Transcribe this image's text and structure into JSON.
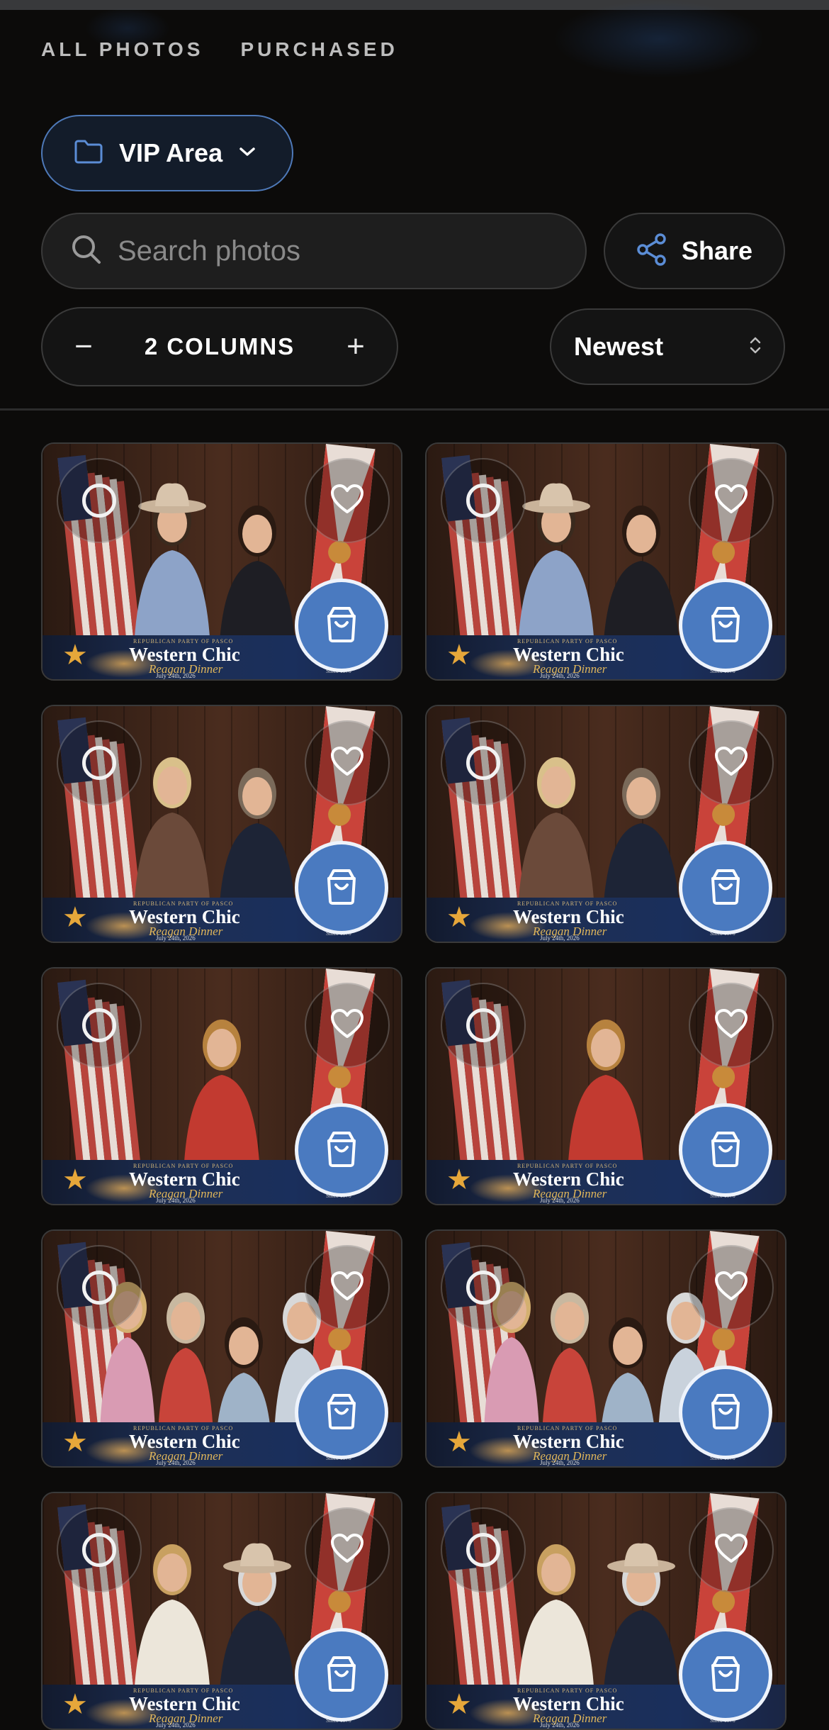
{
  "tabs": [
    "ALL PHOTOS",
    "PURCHASED"
  ],
  "folder": {
    "label": "VIP Area",
    "icon": "folder-icon"
  },
  "search": {
    "placeholder": "Search photos",
    "value": ""
  },
  "share": {
    "label": "Share"
  },
  "columns": {
    "label": "2 COLUMNS",
    "decrement": "−",
    "increment": "+"
  },
  "sort": {
    "selected": "Newest"
  },
  "colors": {
    "accent": "#4a7ac0",
    "background": "#0c0b0a"
  },
  "event_banner": {
    "org": "REPUBLICAN PARTY OF PASCO",
    "title": "Western Chic",
    "subtitle": "Reagan Dinner",
    "date": "July 24th, 2026",
    "since": "Since 1970"
  },
  "photos": [
    {
      "scene": "couple-cowboy-hat"
    },
    {
      "scene": "couple-cowboy-hat"
    },
    {
      "scene": "couple-suit"
    },
    {
      "scene": "couple-suit"
    },
    {
      "scene": "woman-flag-shirt"
    },
    {
      "scene": "woman-flag-shirt-wave"
    },
    {
      "scene": "family-four"
    },
    {
      "scene": "family-four"
    },
    {
      "scene": "couple-white-hat"
    },
    {
      "scene": "couple-white-hat"
    }
  ]
}
